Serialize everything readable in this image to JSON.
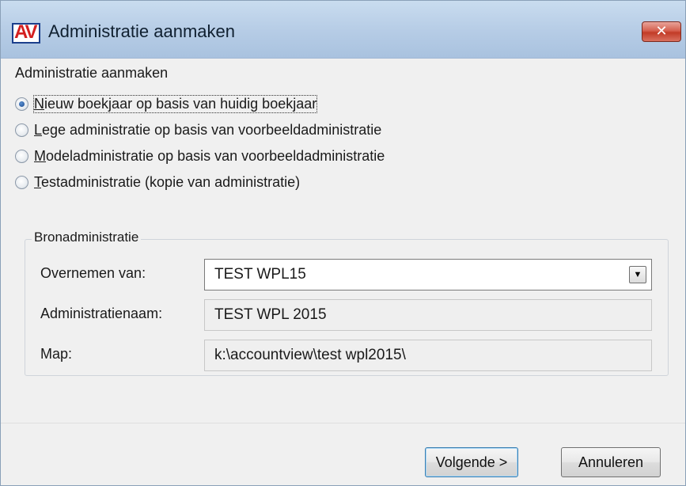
{
  "window": {
    "title": "Administratie aanmaken",
    "icon": "AV",
    "close": "✕"
  },
  "section": {
    "heading": "Administratie aanmaken"
  },
  "options": [
    {
      "label": "Nieuw boekjaar op basis van huidig boekjaar",
      "accel": "N",
      "rest": "ieuw boekjaar op basis van huidig boekjaar",
      "checked": true
    },
    {
      "label": "Lege administratie op basis van voorbeeldadministratie",
      "accel": "L",
      "rest": "ege administratie op basis van voorbeeldadministratie",
      "checked": false
    },
    {
      "label": "Modeladministratie op basis van voorbeeldadministratie",
      "accel": "M",
      "rest": "odeladministratie op basis van voorbeeldadministratie",
      "checked": false
    },
    {
      "label": "Testadministratie (kopie van administratie)",
      "accel": "T",
      "rest": "estadministratie (kopie van administratie)",
      "checked": false
    }
  ],
  "source": {
    "caption": "Bronadministratie",
    "copy_from_label": "Overnemen van:",
    "copy_from_value": "TEST WPL15",
    "name_label": "Administratienaam:",
    "name_value": "TEST WPL 2015",
    "folder_label": "Map:",
    "folder_value": "k:\\accountview\\test wpl2015\\"
  },
  "buttons": {
    "next": "Volgende >",
    "cancel": "Annuleren"
  },
  "icons": {
    "dropdown": "▼"
  },
  "colors": {
    "titlebar": "#b7cde6",
    "close": "#c23b27",
    "logo_red": "#d42020",
    "logo_blue": "#1b3f8c"
  }
}
